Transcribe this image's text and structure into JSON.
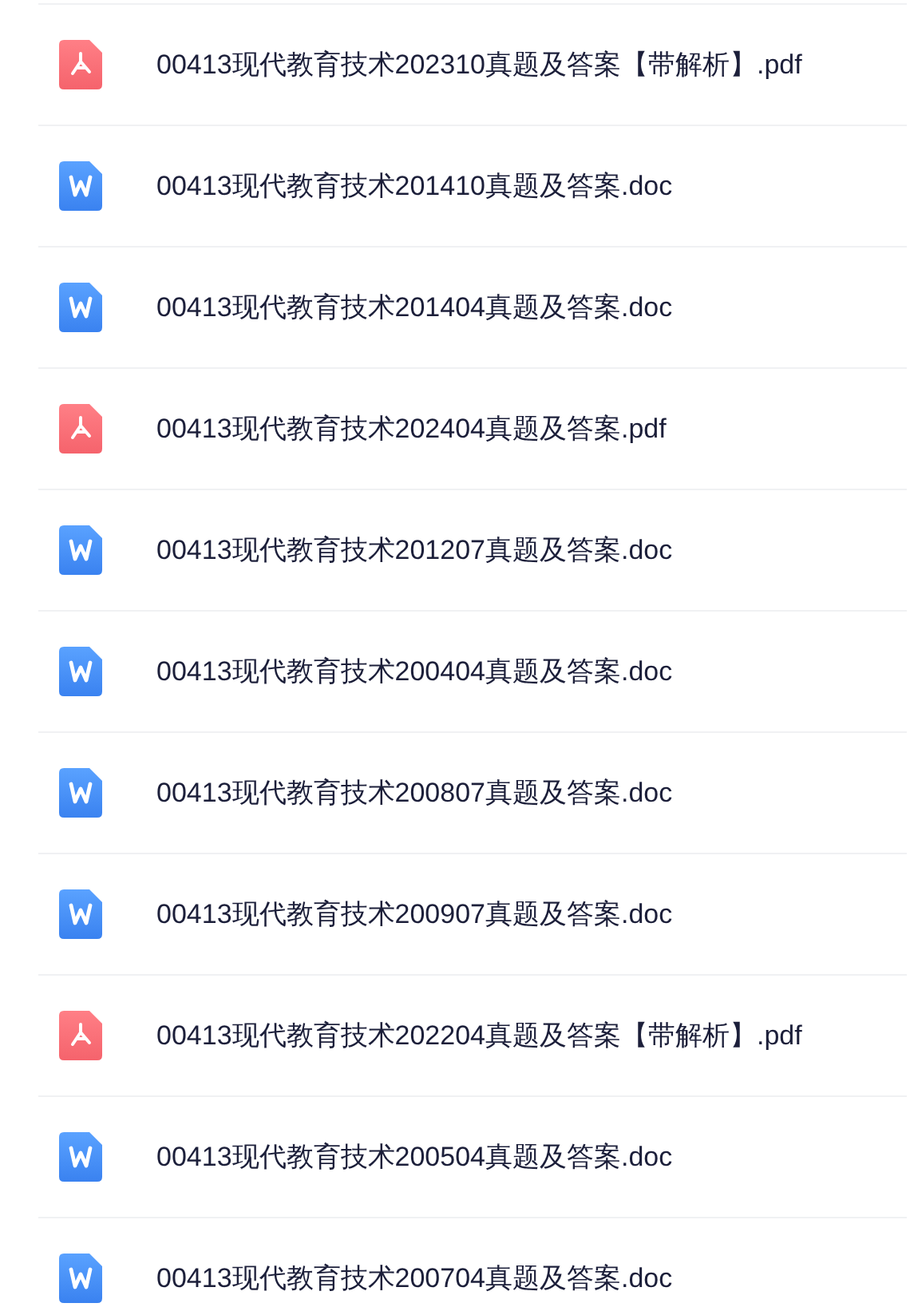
{
  "files": [
    {
      "kind": "pdf",
      "name": "00413现代教育技术202310真题及答案【带解析】.pdf"
    },
    {
      "kind": "doc",
      "name": "00413现代教育技术201410真题及答案.doc"
    },
    {
      "kind": "doc",
      "name": "00413现代教育技术201404真题及答案.doc"
    },
    {
      "kind": "pdf",
      "name": "00413现代教育技术202404真题及答案.pdf"
    },
    {
      "kind": "doc",
      "name": "00413现代教育技术201207真题及答案.doc"
    },
    {
      "kind": "doc",
      "name": "00413现代教育技术200404真题及答案.doc"
    },
    {
      "kind": "doc",
      "name": "00413现代教育技术200807真题及答案.doc"
    },
    {
      "kind": "doc",
      "name": "00413现代教育技术200907真题及答案.doc"
    },
    {
      "kind": "pdf",
      "name": "00413现代教育技术202204真题及答案【带解析】.pdf"
    },
    {
      "kind": "doc",
      "name": "00413现代教育技术200504真题及答案.doc"
    },
    {
      "kind": "doc",
      "name": "00413现代教育技术200704真题及答案.doc"
    }
  ]
}
